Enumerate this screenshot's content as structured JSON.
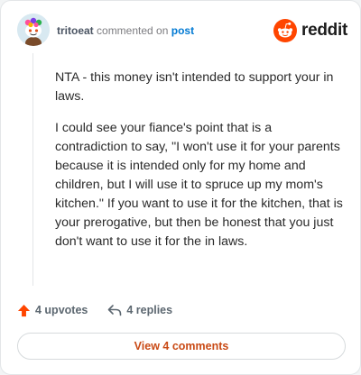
{
  "comment": {
    "author": "tritoeat",
    "action_text": "commented on",
    "post_link": "post",
    "paragraphs": [
      "NTA - this money isn't intended to support your in laws.",
      "I could see your fiance's point that is a contradiction to say, \"I won't use it for your parents because it is intended only for my home and children, but I will use it to spruce up my mom's kitchen.\" If you want to use it for the kitchen, that is your prerogative, but then be honest that you just don't want to use it for the in laws."
    ]
  },
  "brand": {
    "wordmark": "reddit",
    "logo_icon": "reddit-snoo-icon",
    "accent_color": "#ff4500"
  },
  "actions": {
    "upvotes_label": "4 upvotes",
    "upvote_icon": "upvote-arrow-icon",
    "upvote_color": "#ff4500",
    "replies_label": "4 replies",
    "reply_icon": "reply-arrow-icon"
  },
  "footer": {
    "view_comments_label": "View 4 comments"
  }
}
